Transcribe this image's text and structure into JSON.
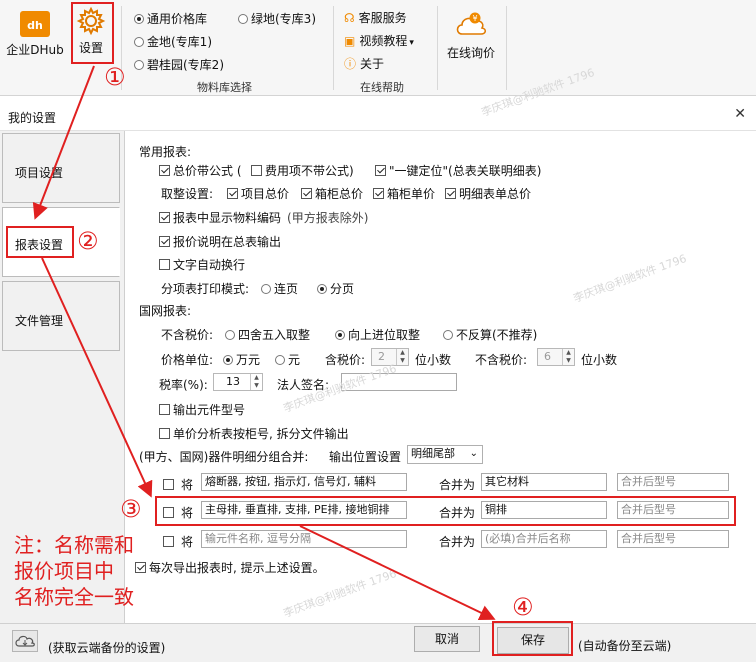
{
  "ribbon": {
    "enterprise_label": "企业DHub",
    "settings_label": "设置",
    "library": {
      "options": [
        "通用价格库",
        "绿地(专库3)",
        "金地(专库1)",
        "碧桂园(专库2)"
      ],
      "selected": "通用价格库",
      "group_label": "物料库选择"
    },
    "help": {
      "items": [
        "客服服务",
        "视频教程",
        "关于"
      ],
      "dropdown_mark": "▾",
      "group_label": "在线帮助"
    },
    "online_price_label": "在线询价"
  },
  "dialog": {
    "title": "我的设置",
    "close": "✕"
  },
  "sidebar": {
    "items": [
      "项目设置",
      "报表设置",
      "文件管理"
    ],
    "selected": "报表设置"
  },
  "settings": {
    "common_title": "常用报表:",
    "total_formula": "总价带公式 (",
    "fee_no_formula": "费用项不带公式)",
    "one_key_locate": "\"一键定位\"(总表关联明细表)",
    "rounding_label": "取整设置:",
    "round_options": [
      "项目总价",
      "箱柜总价",
      "箱柜单价",
      "明细表单总价"
    ],
    "show_material_code": "报表中显示物料编码",
    "show_material_code_note": "(甲方报表除外)",
    "price_desc_total": "报价说明在总表输出",
    "text_wrap": "文字自动换行",
    "print_mode_label": "分项表打印模式:",
    "print_options": [
      "连页",
      "分页"
    ],
    "print_selected": "分页",
    "national_title": "国网报表:",
    "tax_excl_label": "不含税价:",
    "tax_excl_options": [
      "四舍五入取整",
      "向上进位取整",
      "不反算(不推荐)"
    ],
    "tax_excl_selected": "向上进位取整",
    "unit_label": "价格单位:",
    "unit_options": [
      "万元",
      "元"
    ],
    "unit_selected": "万元",
    "tax_incl_price_label": "含税价:",
    "tax_incl_digits": "2",
    "decimal_suffix": "位小数",
    "tax_excl_price_label": "不含税价:",
    "tax_excl_digits": "6",
    "tax_rate_label": "税率(%):",
    "tax_rate_value": "13",
    "legal_sign_label": "法人签名:",
    "legal_sign_value": "",
    "output_component_model": "输出元件型号",
    "unit_price_split": "单价分析表按柜号, 拆分文件输出",
    "merge_label": "(甲方、国网)器件明细分组合并:",
    "output_pos_label": "输出位置设置",
    "output_pos_value": "明细尾部",
    "merge_rows": [
      {
        "prefix": "将",
        "names": "熔断器, 按钮, 指示灯, 信号灯, 辅料",
        "join": "合并为",
        "target": "其它材料",
        "model": "合并后型号"
      },
      {
        "prefix": "将",
        "names": "主母排, 垂直排, 支排, PE排, 接地铜排",
        "join": "合并为",
        "target": "铜排",
        "model": "合并后型号"
      },
      {
        "prefix": "将",
        "names": "输元件名称, 逗号分隔",
        "join": "合并为",
        "target": "(必填)合并后名称",
        "model": "合并后型号"
      }
    ],
    "export_prompt": "每次导出报表时, 提示上述设置。"
  },
  "footer": {
    "cloud_label": "(获取云端备份的设置)",
    "cancel_label": "取消",
    "save_label": "保存",
    "auto_backup_label": "(自动备份至云端)"
  },
  "annotations": {
    "n1": "①",
    "n2": "②",
    "n3": "③",
    "n4": "④",
    "note": "注：名称需和\n报价项目中\n名称完全一致",
    "watermark": "李庆琪@利驰软件 1796"
  },
  "colors": {
    "accent_orange": "#f08a00",
    "annotation_red": "#e02020"
  }
}
